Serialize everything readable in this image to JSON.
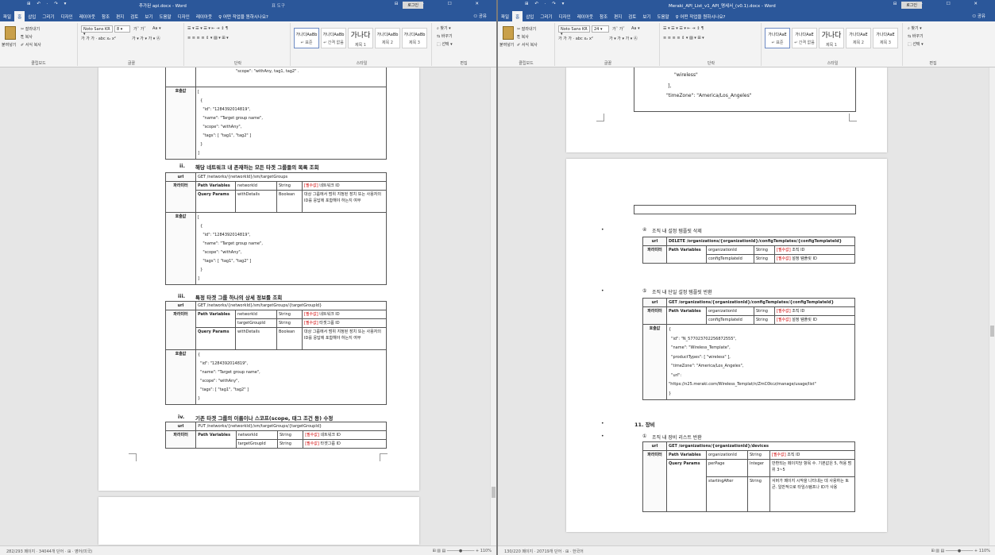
{
  "left": {
    "qa": "⊞ ↶ · ↷ ▾",
    "title": "추가된 api.docx - Word",
    "tool_tab": "표 도구",
    "login": "로그인",
    "win_controls": "⊟ – ☐ ✕",
    "menu": [
      "파일",
      "홈",
      "삽입",
      "그리기",
      "디자인",
      "레이아웃",
      "참조",
      "편지",
      "검토",
      "보기",
      "도움말",
      "디자인",
      "레이아웃",
      "♀ 어떤 작업을 원하시나요?"
    ],
    "share": "⚇ 공유",
    "ribbon": {
      "paste": "붙여넣기",
      "cut": "✂ 잘라내기",
      "copy": "⎘ 복사",
      "fmt": "✐ 서식 복사",
      "font": "Noto Sans KR ▾",
      "size": "8 ▾",
      "grow": "가ˆ 가ˇ",
      "aa": "Aa ▾",
      "fmt_row": "가 가 가 · abc x₂ x²",
      "color_row": "가 ▾ 가 ▾ 가 ▾ Ⓐ",
      "para_row1": "☰ ▾ ☰ ▾ ☰ ▾ ⇤ ⇥ ↕ ¶",
      "para_row2": "≡ ≡ ≡ ≡ ⇕ ▾ ▨ ▾ ⊞ ▾",
      "clipboard": "클립보드",
      "fontg": "글꼴",
      "para": "단락",
      "styles_label": "스타일",
      "edit": "편집",
      "styles": [
        {
          "s": "가나다AaBb",
          "n": "↵ 표준"
        },
        {
          "s": "가나다AaBb",
          "n": "↵ 간격 없음"
        },
        {
          "s": "가나다",
          "n": "제목 1"
        },
        {
          "s": "가나다AaBb",
          "n": "제목 2"
        },
        {
          "s": "가나다AaBb",
          "n": "제목 3"
        }
      ],
      "find": "⌕ 찾기 ▾",
      "replace": "⇆ 바꾸기",
      "select": "⬚ 선택 ▾"
    },
    "status": "282/293 페이지 · 34044개 단어 · ⊞ · 영어(미국)",
    "zoom": "⊞ ▥ ▤ ─────●───── + 110%",
    "tA": {
      "label": "호출값",
      "body": "[\n  {\n    \"id\": \"1284392014819\",\n    \"name\": \"Target group name\",\n    \"scope\": \"withAny\",\n    \"tags\": [ \"tag1\", \"tag2\" ]\n  }\n]"
    },
    "scope_line": "\"scope\": \"withAny, tag1, tag2\" .",
    "s2": {
      "num": "ii.",
      "title": "해당 네트워크 내 존재하는 모든 타겟 그룹들의 목록 조회"
    },
    "s2tbl": {
      "url_label": "url",
      "url": "GET /networks/{networkId}/sm/targetGroups",
      "params": "파라미터",
      "pv": "Path Variables",
      "qp": "Query Params",
      "networkId": "networkId",
      "withDetails": "withDetails",
      "String": "String",
      "Boolean": "Boolean",
      "req": "[필수값]",
      "net_desc": "네트워크 ID",
      "wd_desc": "대상 그룹에서 범위 지정된 장치 또는 사용자의 ID를 응답에 포함해야 하는지 여부",
      "resp": "호출값",
      "body": "[\n  {\n    \"id\": \"1284392014819\",\n    \"name\": \"Target group name\",\n    \"scope\": \"withAny\",\n    \"tags\": [ \"tag1\", \"tag2\" ]\n  }\n]"
    },
    "s3": {
      "num": "iii.",
      "title": "특정 타겟 그룹 하나의 상세 정보를 조회"
    },
    "s3tbl": {
      "url": "GET /networks/{networkId}/sm/targetGroups/{targetGroupId}",
      "targetGroupId": "targetGroupId",
      "tg_desc": "타겟그룹 ID",
      "body": "{\n  \"id\": \"1284392014819\",\n  \"name\": \"Target group name\",\n  \"scope\": \"withAny\",\n  \"tags\": [ \"tag1\", \"tag2\" ]\n}"
    },
    "s4": {
      "num": "iv.",
      "title": "기존 타겟 그룹의 이름이나 스코프(scope, 태그 조건 등) 수정"
    },
    "s4tbl": {
      "url": "PUT /networks/{networkId}/sm/targetGroups/{targetGroupId}"
    }
  },
  "right": {
    "title": "Meraki_API_List_v1_API_명세서_(v0.1).docx - Word",
    "menu": [
      "파일",
      "홈",
      "삽입",
      "그리기",
      "디자인",
      "레이아웃",
      "참조",
      "편지",
      "검토",
      "보기",
      "도움말",
      "♀ 어떤 작업을 원하시나요?"
    ],
    "font": "Noto Sans KR ▾",
    "size": "24 ▾",
    "styles": [
      {
        "s": "가나다AaE",
        "n": "↵ 표준"
      },
      {
        "s": "가나다AaE",
        "n": "↵ 간격 없음"
      },
      {
        "s": "가나다",
        "n": "제목 1"
      },
      {
        "s": "가나다AaE",
        "n": "제목 2"
      },
      {
        "s": "가나다AaE",
        "n": "제목 3"
      }
    ],
    "status": "130/220 페이지 · 20719개 단어 · ⊞ · 한국어",
    "top_lines": [
      "\"wireless\"",
      "],",
      "\"timeZone\": \"America/Los_Angeles\""
    ],
    "p4": {
      "mark": "④",
      "title": "조직 내 설정 템플릿 삭제"
    },
    "p4tbl": {
      "url": "DELETE /organizations/{organizationId}/configTemplates/{configTemplateId}",
      "path": "Path Variables",
      "org": "organizationId",
      "tpl": "configTemplateId",
      "org_desc": "조직 ID",
      "tpl_desc": "설정 템플릿 ID"
    },
    "p5": {
      "mark": "⑤",
      "title": "조직 내 단일 설정 템플릿 반환"
    },
    "p5tbl": {
      "url": "GET /organizations/{organizationId}/configTemplates/{configTemplateId}",
      "body": "{\n  \"id\": \"N_577023702256872555\",\n  \"name\": \"Wireless_Template\",\n  \"productTypes\": [ \"wireless\" ],\n  \"timeZone\": \"America/Los_Angeles\",\n  \"url\":\n\"https://n25.meraki.com/Wireless_Templat/n/ZmC0kcz/manage/usage/list\"\n}"
    },
    "h11": "11. 장비",
    "p1": {
      "mark": "①",
      "title": "조직 내 장비 리스트 반환"
    },
    "p1tbl": {
      "url": "GET /organizations/{organizationId}/devices",
      "perPage": "perPage",
      "Integer": "Integer",
      "pp_desc": "반환되는 페이지당 항목 수. 기본값은 5, 허용 범위 3~5",
      "sa": "startingAfter",
      "sa_desc": "서버가 페이지 시작을 나타내는 데 사용하는 토큰. 일반적으로 타임스탬프나 ID가 사용"
    }
  }
}
